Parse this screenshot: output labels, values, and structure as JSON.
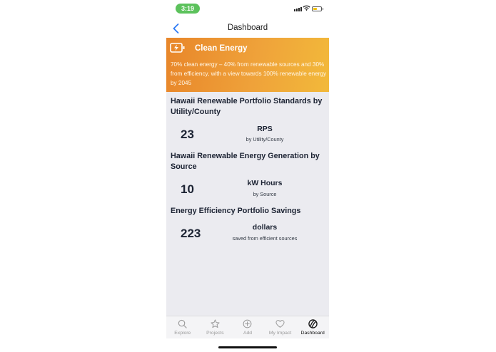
{
  "status_bar": {
    "time": "3:19"
  },
  "nav": {
    "title": "Dashboard"
  },
  "banner": {
    "title": "Clean Energy",
    "description": "70% clean energy – 40% from renewable sources and 30% from efficiency, with a view towards 100% renewable energy by 2045",
    "icon": "battery-charging-icon"
  },
  "sections": [
    {
      "title": "Hawaii Renewable Portfolio Standards by Utility/County",
      "value": "23",
      "unit": "RPS",
      "sub": "by Utility/County"
    },
    {
      "title": "Hawaii Renewable Energy Generation by Source",
      "value": "10",
      "unit": "kW Hours",
      "sub": "by Source"
    },
    {
      "title": "Energy Efficiency Portfolio Savings",
      "value": "223",
      "unit": "dollars",
      "sub": "saved from efficient sources"
    }
  ],
  "tabs": [
    {
      "label": "Explore",
      "icon": "search-icon",
      "active": false
    },
    {
      "label": "Projects",
      "icon": "star-icon",
      "active": false
    },
    {
      "label": "Add",
      "icon": "add-circle-icon",
      "active": false
    },
    {
      "label": "My Impact",
      "icon": "heart-icon",
      "active": false
    },
    {
      "label": "Dashboard",
      "icon": "dashboard-icon",
      "active": true
    }
  ],
  "colors": {
    "banner_start": "#e8862a",
    "banner_end": "#f2b93a",
    "content_bg": "#ebebf0",
    "text_dark": "#1c2333",
    "back_blue": "#2f7bf5",
    "time_green": "#5cc25c"
  }
}
